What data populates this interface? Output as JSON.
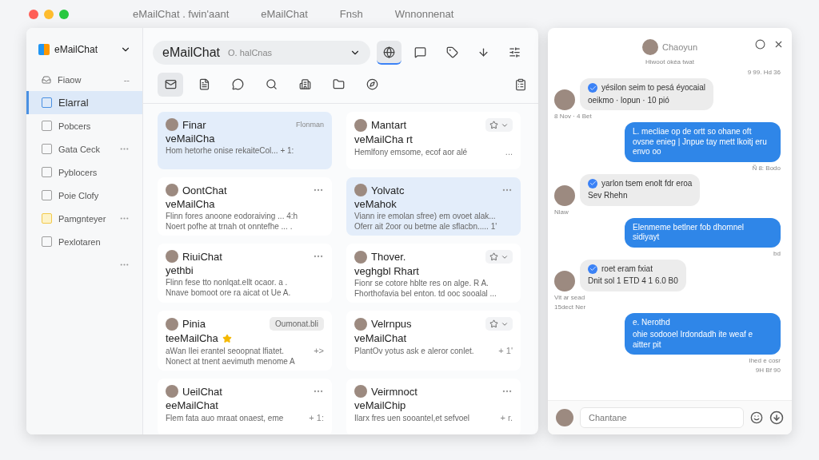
{
  "desktop": {
    "window_dots": [
      {
        "color": "#ff5f57"
      },
      {
        "color": "#febc2e"
      },
      {
        "color": "#28c840"
      }
    ],
    "background_tabs": [
      "eMailChat . fwin'aant",
      "eMailChat",
      "Fnsh",
      "Wnnonnenat"
    ]
  },
  "sidebar": {
    "brand": "eMailChat",
    "header": {
      "label": "Fiaow",
      "more": "--"
    },
    "items": [
      {
        "label": "Elarral",
        "selected": true,
        "color": "#4a90e2",
        "more": false
      },
      {
        "label": "Pobcers",
        "selected": false,
        "color": "#9e9e9e",
        "more": false
      },
      {
        "label": "Gata Ceck",
        "selected": false,
        "color": "#9e9e9e",
        "more": true
      },
      {
        "label": "Pyblocers",
        "selected": false,
        "color": "#9e9e9e",
        "more": false
      },
      {
        "label": "Poie Clofy",
        "selected": false,
        "color": "#9e9e9e",
        "more": false
      },
      {
        "label": "Pamgnteyer",
        "selected": false,
        "color": "#f2c94c",
        "more": true
      },
      {
        "label": "Pexlotaren",
        "selected": false,
        "color": "#9e9e9e",
        "more": false
      }
    ]
  },
  "search": {
    "value": "eMailChat",
    "placeholder": "O. halCnas"
  },
  "top_actions": [
    {
      "selected": true
    },
    {
      "selected": false
    },
    {
      "selected": false
    },
    {
      "selected": false
    },
    {
      "selected": false
    }
  ],
  "tool_icons": [
    {
      "selected": true
    },
    {
      "selected": false
    },
    {
      "selected": false
    },
    {
      "selected": false
    },
    {
      "selected": false
    },
    {
      "selected": false
    },
    {
      "selected": false
    }
  ],
  "cards": [
    {
      "sender": "Finar",
      "subject": "veMailCha",
      "lines": [
        "Hom hetorhe onise rekaiteCol... + 1:"
      ],
      "kind": "label",
      "tag": "Flonman",
      "selected": true,
      "starred": false
    },
    {
      "sender": "Mantart",
      "subject": "veMailCha rt",
      "lines": [
        "Hemlfony emsome, ecof aor alé"
      ],
      "kind": "star",
      "trail": "...",
      "selected": false,
      "starred": false
    },
    {
      "sender": "OontChat",
      "subject": "veMailCha",
      "lines": [
        "Flinn fores anoone eodoraiving ... 4:h",
        "Noert pofhe at trnah ot onntefhe ... ."
      ],
      "kind": "menu",
      "selected": false,
      "starred": false
    },
    {
      "sender": "Yolvatc",
      "subject": "veMahok",
      "lines": [
        "Viann ire emolan sfree) em ovoet alak...",
        "Oferr ait 2oor ou betme ale sflacbn..... 1'"
      ],
      "kind": "menu",
      "selected": true,
      "starred": false
    },
    {
      "sender": "RiuiChat",
      "subject": "yethbi",
      "lines": [
        "Flinn fese tto nonlqat.ellt ocaor. a .",
        "Nnave bomoot ore ra aicat ot Ue A."
      ],
      "kind": "menu",
      "selected": false,
      "starred": false
    },
    {
      "sender": "Thover.",
      "subject": "veghgbl Rhart",
      "lines": [
        "Fionr se cotore hblte res on alge. R A.",
        "Fhorthofavia bel enton. td ooc sooalal ..."
      ],
      "kind": "star",
      "selected": false,
      "starred": false
    },
    {
      "sender": "Pinia",
      "subject": "teeMailCha",
      "lines": [
        "aWan Ilei erantel seoopnat lfiatet.",
        "Nonect at tnent aevimuth menome A"
      ],
      "kind": "badge",
      "tag": "Oumonat.bli",
      "trail": "+>",
      "selected": false,
      "starred": true
    },
    {
      "sender": "Velrnpus",
      "subject": "veMailChat",
      "lines": [
        "PlantOv yotus ask e aleror conlet."
      ],
      "kind": "star",
      "trail": "+ 1'",
      "selected": false,
      "starred": false
    },
    {
      "sender": "UeilChat",
      "subject": "eeMailChat",
      "lines": [
        "Flem fata auo mraat onaest, eme"
      ],
      "kind": "menu",
      "trail": "+ 1:",
      "selected": false,
      "starred": false
    },
    {
      "sender": "Veirmnoct",
      "subject": "veMailChip",
      "lines": [
        "Ilarx fres uen sooantel,et sefvoel"
      ],
      "kind": "menu",
      "trail": "+ r.",
      "selected": false,
      "starred": false
    }
  ],
  "chat": {
    "name": "Chaoyun",
    "status": "Hiwoot ókéa twat",
    "top_time": "9 99. Hd 36",
    "messages": [
      {
        "kind": "incoming",
        "lines": [
          "yésilon seim to pesá éyocaial",
          "oeikmo · lopun · 10 pió"
        ],
        "after": [
          "8 Nov · 4 Bet"
        ]
      },
      {
        "kind": "outgoing",
        "lines": [
          "L. mecliae op de ortt so ohane oft ovsne enieg | Jnpue tay mett lkoitj eru envo oo"
        ],
        "after": [
          "Ñ 8: Bodo"
        ]
      },
      {
        "kind": "incoming",
        "lines": [
          "yarlon tsem enolt fdr eroa",
          "Sev Rhehn"
        ],
        "after": [
          "Nlaw"
        ]
      },
      {
        "kind": "outgoing",
        "lines": [
          "Elenmeme betlner fob dhomnel sidiyayt"
        ],
        "after": [
          "bd"
        ]
      },
      {
        "kind": "incoming",
        "lines": [
          "roet eram fxiat",
          "Dnit sol 1 ETD 4 1 6.0 B0"
        ],
        "after": [
          "Vit ar sead",
          "15dect Ner"
        ]
      },
      {
        "kind": "outgoing",
        "lines": [
          "e. Nerothd",
          "ohie sodooel Irdondadh ite weaf e aitter pit"
        ],
        "after": [
          "Ihed e cosr",
          "9H Bf 90"
        ]
      }
    ],
    "input": {
      "placeholder": "Chantane"
    }
  }
}
